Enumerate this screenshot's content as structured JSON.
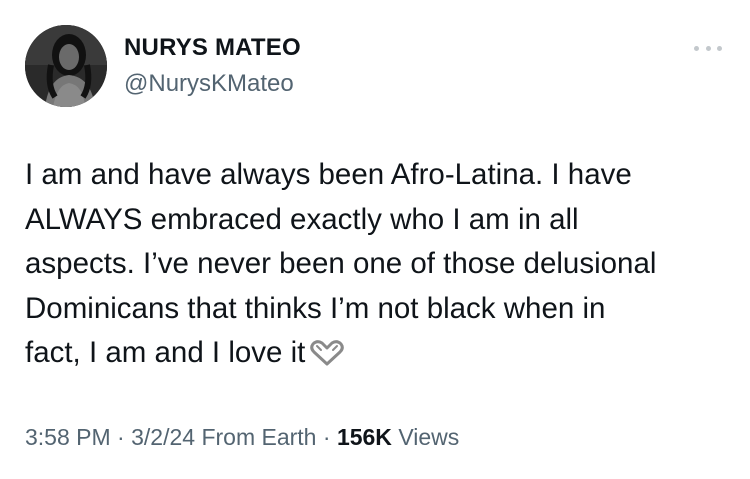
{
  "author": {
    "display_name": "NURYS MATEO",
    "handle": "@NurysKMateo"
  },
  "menu_icon": "more-horizontal-icon",
  "tweet": {
    "lines": [
      "I am and have always been Afro-Latina. I have",
      "ALWAYS embraced exactly who I am in all",
      "aspects. I’ve never been one of those delusional",
      "Dominicans that thinks I’m not black when in",
      "fact, I am and I love it"
    ],
    "emoji": "heart-hands-emoji"
  },
  "meta": {
    "time": "3:58 PM",
    "separator": "·",
    "date": "3/2/24",
    "source": "From Earth",
    "views_count": "156K",
    "views_label": "Views"
  }
}
